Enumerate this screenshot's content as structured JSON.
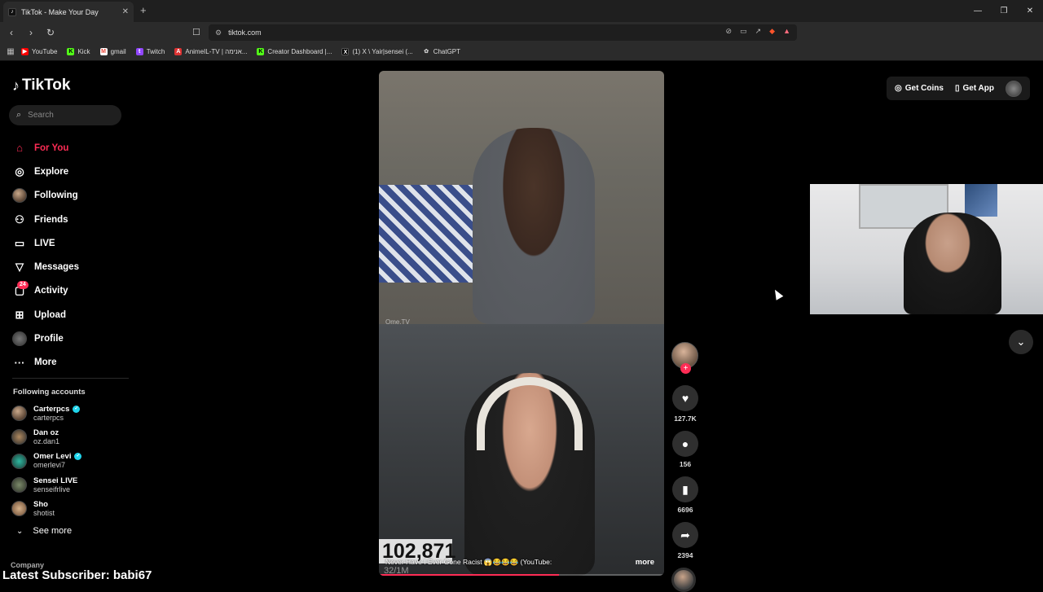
{
  "browser": {
    "tab_title": "TikTok - Make Your Day",
    "tab_icon": "tiktok-icon",
    "new_tab": "+",
    "url": "tiktok.com",
    "window_controls": [
      "—",
      "❐",
      "✕"
    ],
    "bookmarks": [
      {
        "label": "YouTube",
        "icon": "youtube-icon",
        "color": "#ff0000"
      },
      {
        "label": "Kick",
        "icon": "kick-icon",
        "color": "#53fc18"
      },
      {
        "label": "gmail",
        "icon": "gmail-icon",
        "color": "#ea4335"
      },
      {
        "label": "Twitch",
        "icon": "twitch-icon",
        "color": "#9146ff"
      },
      {
        "label": "AnimeIL-TV | אנימה...",
        "icon": "animeil-icon",
        "color": "#d33"
      },
      {
        "label": "Creator Dashboard |...",
        "icon": "kick-icon",
        "color": "#53fc18"
      },
      {
        "label": "(1) X \\ Yair|sensei (...",
        "icon": "x-icon",
        "color": "#ffffff"
      },
      {
        "label": "ChatGPT",
        "icon": "chatgpt-icon",
        "color": "#cccccc"
      }
    ]
  },
  "sidebar": {
    "logo": "TikTok",
    "search_placeholder": "Search",
    "nav": [
      {
        "label": "For You",
        "icon": "home-icon",
        "active": true
      },
      {
        "label": "Explore",
        "icon": "compass-icon"
      },
      {
        "label": "Following",
        "icon": "following-avatar"
      },
      {
        "label": "Friends",
        "icon": "friends-icon"
      },
      {
        "label": "LIVE",
        "icon": "live-icon"
      },
      {
        "label": "Messages",
        "icon": "messages-icon"
      },
      {
        "label": "Activity",
        "icon": "activity-icon",
        "badge": "24"
      },
      {
        "label": "Upload",
        "icon": "upload-icon"
      },
      {
        "label": "Profile",
        "icon": "profile-avatar"
      },
      {
        "label": "More",
        "icon": "more-icon"
      }
    ],
    "following_title": "Following accounts",
    "following": [
      {
        "name": "Carterpcs",
        "handle": "carterpcs",
        "verified": true
      },
      {
        "name": "Dan oz",
        "handle": "oz.dan1",
        "verified": false
      },
      {
        "name": "Omer Levi",
        "handle": "omerlevi7",
        "verified": true
      },
      {
        "name": "Sensei LIVE",
        "handle": "senseifrlive",
        "verified": false
      },
      {
        "name": "Sho",
        "handle": "shotist",
        "verified": false
      }
    ],
    "see_more": "See more",
    "company": "Company"
  },
  "overlay": {
    "latest_subscriber": "Latest Subscriber: babi67"
  },
  "video": {
    "watermark": "Ome.TV",
    "counter": "102,871",
    "counter_sub": "32/1M",
    "caption": "Never Have I Ever Gone Racist 😱😂😂😂 (YouTube:",
    "more": "more",
    "progress": 0.63
  },
  "actions": {
    "likes": "127.7K",
    "comments": "156",
    "saves": "6696",
    "shares": "2394"
  },
  "header": {
    "get_coins": "Get Coins",
    "get_app": "Get App"
  },
  "colors": {
    "accent": "#fe2c55",
    "verified": "#20d5ec"
  }
}
